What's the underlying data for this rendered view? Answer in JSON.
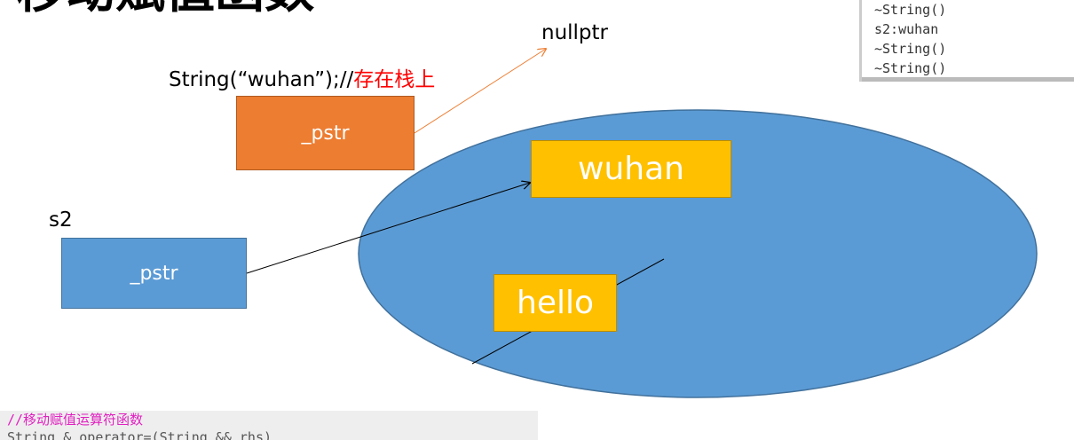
{
  "title": "移动赋值函数",
  "console": {
    "lines": [
      "~String()",
      "s2:wuhan",
      "~String()",
      "~String()"
    ]
  },
  "code": {
    "lines": [
      "//移动赋值运算符函数",
      "String & operator=(String && rhs)"
    ]
  },
  "diagram": {
    "temp_label": "String(“wuhan”);//",
    "temp_note": "存在栈上",
    "temp_box": "_pstr",
    "nullptr": "nullptr",
    "s2_label": "s2",
    "s2_box": "_pstr",
    "wuhan": "wuhan",
    "hello": "hello"
  },
  "colors": {
    "orange": "#ed7d31",
    "blue": "#5b9bd5",
    "yellow": "#ffc000",
    "red": "#ff0000"
  }
}
